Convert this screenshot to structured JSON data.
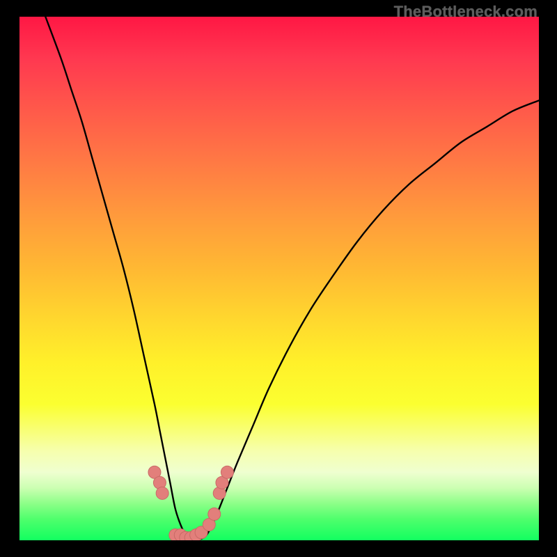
{
  "attribution": "TheBottleneck.com",
  "colors": {
    "marker_fill": "#e27f7b",
    "marker_stroke": "#c96a66",
    "curve_stroke": "#000000",
    "frame_bg": "#000000"
  },
  "chart_data": {
    "type": "line",
    "title": "",
    "xlabel": "",
    "ylabel": "",
    "xlim": [
      0,
      100
    ],
    "ylim": [
      0,
      100
    ],
    "grid": false,
    "legend": false,
    "series": [
      {
        "name": "bottleneck-curve",
        "x": [
          5,
          8,
          10,
          12,
          14,
          16,
          18,
          20,
          22,
          24,
          26,
          27,
          28,
          29,
          30,
          31,
          32,
          33,
          34,
          36,
          38,
          40,
          42,
          45,
          48,
          52,
          56,
          60,
          65,
          70,
          75,
          80,
          85,
          90,
          95,
          100
        ],
        "y": [
          100,
          92,
          86,
          80,
          73,
          66,
          59,
          52,
          44,
          35,
          26,
          21,
          16,
          11,
          6,
          3,
          1,
          0,
          0,
          1,
          5,
          10,
          15,
          22,
          29,
          37,
          44,
          50,
          57,
          63,
          68,
          72,
          76,
          79,
          82,
          84
        ]
      }
    ],
    "markers": [
      {
        "x": 26,
        "y": 13
      },
      {
        "x": 27,
        "y": 11
      },
      {
        "x": 27.5,
        "y": 9
      },
      {
        "x": 30,
        "y": 1
      },
      {
        "x": 31,
        "y": 1
      },
      {
        "x": 32,
        "y": 0.5
      },
      {
        "x": 33,
        "y": 0.5
      },
      {
        "x": 34,
        "y": 1
      },
      {
        "x": 35,
        "y": 1.5
      },
      {
        "x": 36.5,
        "y": 3
      },
      {
        "x": 37.5,
        "y": 5
      },
      {
        "x": 38.5,
        "y": 9
      },
      {
        "x": 39,
        "y": 11
      },
      {
        "x": 40,
        "y": 13
      }
    ]
  }
}
